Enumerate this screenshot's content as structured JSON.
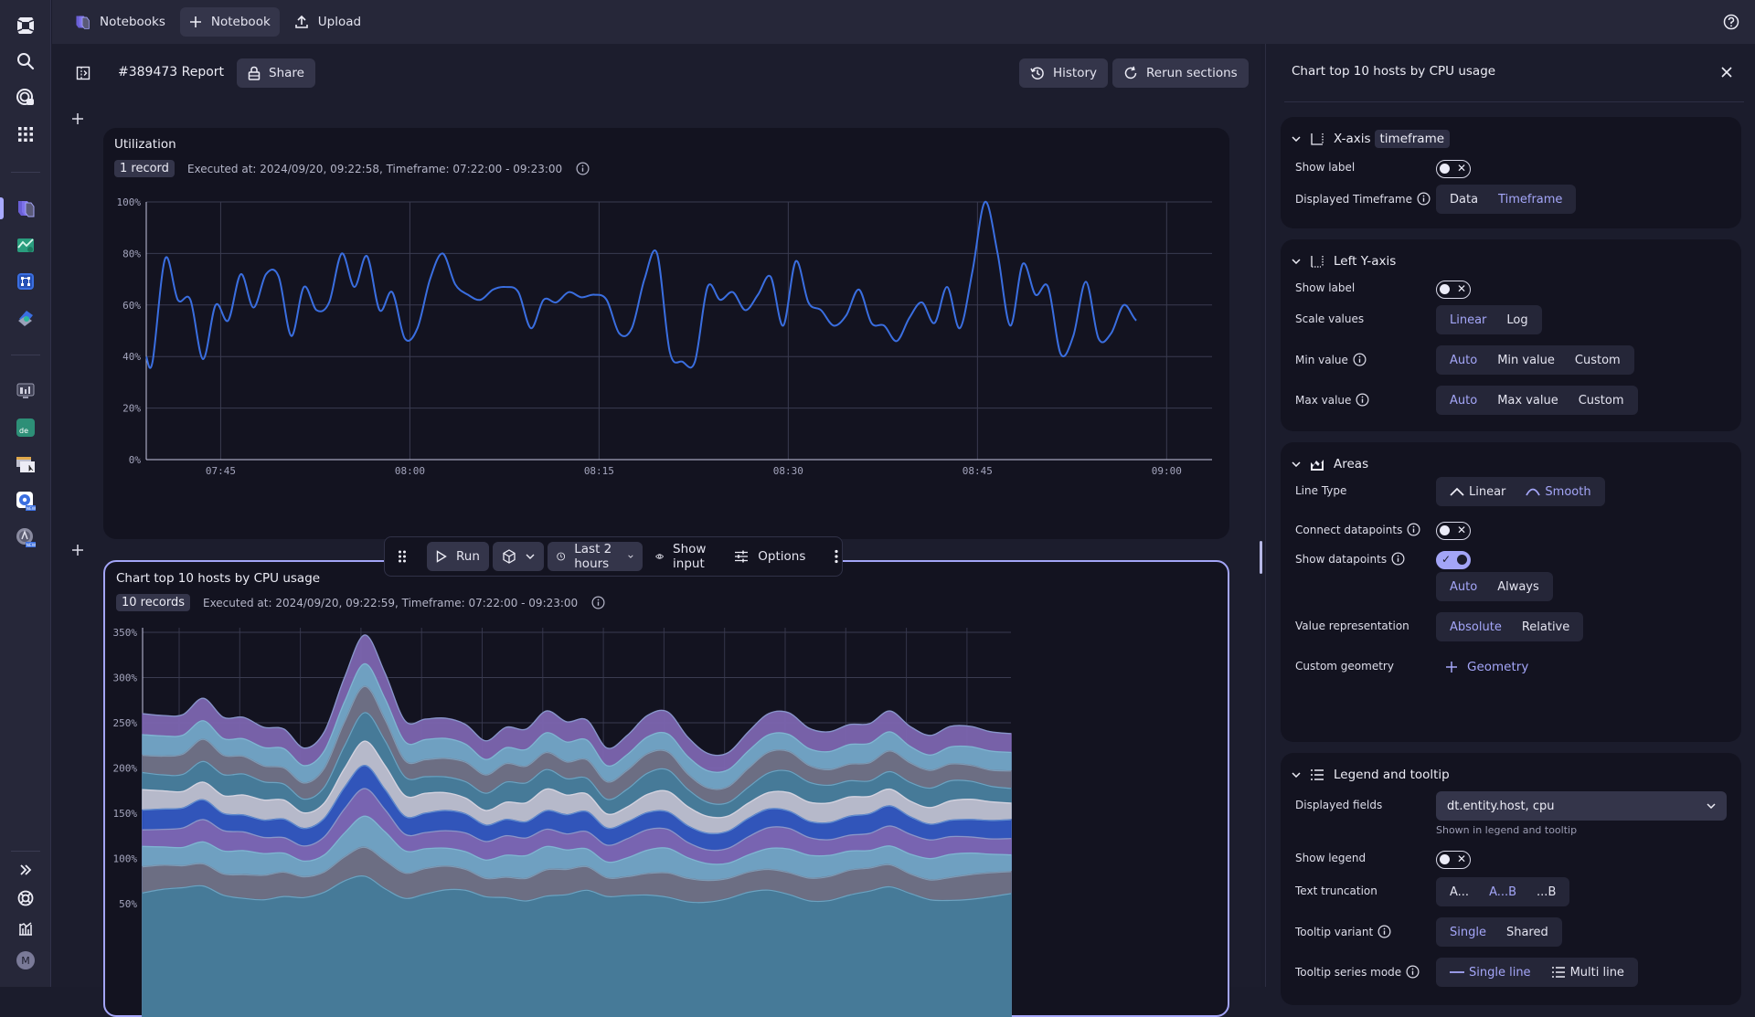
{
  "topbar": {
    "notebooks_label": "Notebooks",
    "new_notebook_label": "Notebook",
    "upload_label": "Upload"
  },
  "leftnav": {
    "items": [
      {
        "icon": "dynatrace-logo-icon"
      },
      {
        "icon": "search-icon"
      },
      {
        "icon": "observe-icon"
      },
      {
        "icon": "apps-grid-icon"
      },
      {
        "icon": "notebooks-app-icon",
        "active": true
      },
      {
        "icon": "dashboards-app-icon"
      },
      {
        "icon": "workflows-app-icon"
      },
      {
        "icon": "security-app-icon"
      },
      {
        "icon": "infrastructure-app-icon"
      },
      {
        "icon": "data-explorer-app-icon",
        "text": "de"
      },
      {
        "icon": "synthetic-app-icon"
      },
      {
        "icon": "kubernetes-app-icon",
        "badge": "NEW"
      },
      {
        "icon": "clouds-app-icon",
        "badge": "NEW"
      },
      {
        "icon": "expand-icon"
      },
      {
        "icon": "support-icon"
      },
      {
        "icon": "whats-new-icon"
      }
    ],
    "user_initial": "M"
  },
  "notebook": {
    "title": "#389473 Report",
    "share_label": "Share",
    "history_label": "History",
    "rerun_label": "Rerun sections"
  },
  "sections": [
    {
      "title": "Utilization",
      "records": "1 record",
      "meta": "Executed at: 2024/09/20, 09:22:58, Timeframe: 07:22:00 - 09:23:00"
    },
    {
      "title": "Chart top 10 hosts by CPU usage",
      "records": "10 records",
      "meta": "Executed at: 2024/09/20, 09:22:59, Timeframe: 07:22:00 - 09:23:00"
    }
  ],
  "section_toolbar": {
    "run_label": "Run",
    "timeframe_label": "Last 2 hours",
    "show_input_label": "Show input",
    "options_label": "Options"
  },
  "panel": {
    "title": "Chart top 10 hosts by CPU usage",
    "xaxis": {
      "heading": "X-axis",
      "field_chip": "timeframe",
      "show_label_text": "Show label",
      "show_label_on": false,
      "displayed_timeframe_label": "Displayed Timeframe",
      "displayed_timeframe_options": [
        "Data",
        "Timeframe"
      ],
      "displayed_timeframe_selected": "Timeframe"
    },
    "yaxis": {
      "heading": "Left Y-axis",
      "show_label_text": "Show label",
      "show_label_on": false,
      "scale_label": "Scale values",
      "scale_options": [
        "Linear",
        "Log"
      ],
      "scale_selected": "Linear",
      "min_label": "Min value",
      "min_options": [
        "Auto",
        "Min value",
        "Custom"
      ],
      "min_selected": "Auto",
      "max_label": "Max value",
      "max_options": [
        "Auto",
        "Max value",
        "Custom"
      ],
      "max_selected": "Auto"
    },
    "areas": {
      "heading": "Areas",
      "line_type_label": "Line Type",
      "line_type_options": [
        "Linear",
        "Smooth"
      ],
      "line_type_selected": "Smooth",
      "connect_label": "Connect datapoints",
      "connect_on": false,
      "show_dp_label": "Show datapoints",
      "show_dp_on": true,
      "show_dp_options": [
        "Auto",
        "Always"
      ],
      "show_dp_selected": "Auto",
      "value_repr_label": "Value representation",
      "value_repr_options": [
        "Absolute",
        "Relative"
      ],
      "value_repr_selected": "Absolute",
      "custom_geom_label": "Custom geometry",
      "add_geometry_label": "Geometry"
    },
    "legend": {
      "heading": "Legend and tooltip",
      "fields_label": "Displayed fields",
      "fields_value": "dt.entity.host, cpu",
      "fields_hint": "Shown in legend and tooltip",
      "show_legend_label": "Show legend",
      "show_legend_on": false,
      "truncation_label": "Text truncation",
      "truncation_options": [
        "A...",
        "A...B",
        "...B"
      ],
      "truncation_selected": "A...B",
      "tooltip_variant_label": "Tooltip variant",
      "tooltip_variant_options": [
        "Single",
        "Shared"
      ],
      "tooltip_variant_selected": "Single",
      "series_mode_label": "Tooltip series mode",
      "series_mode_options": [
        "Single line",
        "Multi line"
      ],
      "series_mode_selected": "Single line"
    }
  },
  "colors": {
    "accent": "#a3a5f7",
    "line_series": "#3a6ee0",
    "area_palette": [
      "#447a99",
      "#6b6b80",
      "#6fa3c2",
      "#7c65b0",
      "#2a4fb8",
      "#bdbdcc",
      "#447a99",
      "#6b6b80",
      "#6fa3c2",
      "#7c65b0"
    ]
  },
  "chart_data": [
    {
      "type": "line",
      "title": "Utilization",
      "xlabel": "",
      "ylabel": "",
      "x_range": [
        "07:39",
        "09:03.5"
      ],
      "xticks": [
        "07:45",
        "08:00",
        "08:15",
        "08:30",
        "08:45",
        "09:00"
      ],
      "yticks": [
        "0%",
        "20%",
        "40%",
        "60%",
        "80%",
        "100%"
      ],
      "ylim": [
        0,
        100
      ],
      "grid": true,
      "legend": "none",
      "series": [
        {
          "name": "cpu",
          "x_minutes": [
            0,
            0.5,
            1.5,
            2.5,
            3.5,
            4.5,
            5.5,
            6.5,
            7.5,
            8.5,
            9.5,
            10.5,
            11.5,
            12.5,
            13.5,
            14.5,
            15.5,
            16.5,
            17.5,
            18.5,
            19.5,
            20.5,
            21.5,
            22.5,
            23.5,
            24.5,
            25.5,
            26.5,
            27.5,
            28.5,
            29.5,
            30.5,
            31.5,
            32.5,
            33.5,
            34.5,
            35.5,
            36.5,
            37.5,
            38.5,
            39.5,
            40.5,
            41.5,
            42.5,
            43.5,
            44.5,
            45.5,
            46.5,
            47.5,
            48.5,
            49.5,
            50.5,
            51.5,
            52.5,
            53.5,
            54.5,
            55.5,
            56.5,
            57.5,
            58.5,
            59.5,
            60.5,
            61.5,
            62.5,
            63.5,
            64.5,
            65.5,
            66.5,
            67.5,
            68.5,
            69.5,
            70.5,
            71.5,
            72.5,
            73.5,
            74.5,
            75.5,
            76.5,
            77.5,
            78.5,
            79.5,
            80.5,
            81.5,
            82.5,
            83.5,
            84.5
          ],
          "values": [
            40,
            38,
            78,
            62,
            62,
            39,
            60,
            54,
            72,
            59,
            72,
            71,
            48,
            67,
            58,
            61,
            80,
            67,
            79,
            58,
            65,
            47,
            51,
            70,
            80,
            68,
            64,
            62,
            66,
            67,
            65,
            51,
            62,
            61,
            65,
            63,
            64,
            62,
            49,
            51,
            70,
            80,
            42,
            38,
            38,
            67,
            62,
            65,
            58,
            64,
            71,
            52,
            77,
            61,
            58,
            52,
            56,
            66,
            53,
            52,
            46,
            55,
            61,
            53,
            67,
            51,
            73,
            100,
            80,
            52,
            76,
            64,
            67,
            41,
            48,
            69,
            47,
            49,
            60,
            54,
            54
          ],
          "note": "values estimated from gridlines; minute offsets from plot start (~07:39)"
        }
      ]
    },
    {
      "type": "area",
      "stacked": true,
      "title": "Chart top 10 hosts by CPU usage",
      "xlabel": "",
      "ylabel": "",
      "yticks": [
        "50%",
        "100%",
        "150%",
        "200%",
        "250%",
        "300%",
        "350%"
      ],
      "ylim_visible": [
        35,
        350
      ],
      "grid": true,
      "legend": "none",
      "x_points": 44,
      "stack_top_total": [
        260,
        258,
        259,
        277,
        256,
        256,
        245,
        243,
        222,
        240,
        300,
        347,
        305,
        252,
        254,
        255,
        248,
        230,
        245,
        243,
        263,
        251,
        253,
        222,
        236,
        258,
        262,
        234,
        216,
        217,
        240,
        260,
        261,
        244,
        240,
        248,
        249,
        263,
        246,
        236,
        246,
        246,
        240,
        238
      ],
      "series_count": 10,
      "note": "10 stacked host series; only total envelope approximated; lower part of chart clipped by viewport"
    }
  ]
}
